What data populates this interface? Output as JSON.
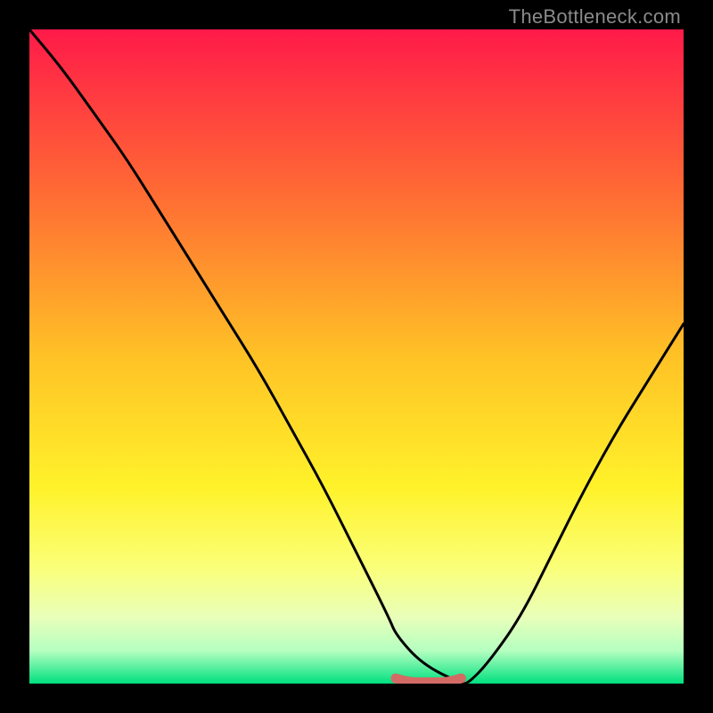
{
  "watermark": "TheBottleneck.com",
  "chart_data": {
    "type": "line",
    "title": "",
    "xlabel": "",
    "ylabel": "",
    "xlim": [
      0,
      100
    ],
    "ylim": [
      0,
      100
    ],
    "legend": false,
    "grid": false,
    "background_gradient": {
      "stops": [
        {
          "pos": 0.0,
          "color": "#ff1a49"
        },
        {
          "pos": 0.25,
          "color": "#ff6b34"
        },
        {
          "pos": 0.5,
          "color": "#ffc226"
        },
        {
          "pos": 0.7,
          "color": "#fff22a"
        },
        {
          "pos": 0.82,
          "color": "#fbff77"
        },
        {
          "pos": 0.9,
          "color": "#e8ffba"
        },
        {
          "pos": 0.95,
          "color": "#b4ffc0"
        },
        {
          "pos": 1.0,
          "color": "#00e07f"
        }
      ]
    },
    "series": [
      {
        "name": "bottleneck-curve",
        "color": "#000000",
        "x": [
          0,
          5,
          10,
          15,
          20,
          25,
          30,
          35,
          40,
          45,
          50,
          55,
          56,
          60,
          66,
          67,
          70,
          75,
          80,
          85,
          90,
          95,
          100
        ],
        "y_top": [
          100,
          94,
          87,
          80,
          72,
          64,
          56,
          48,
          39,
          30,
          20,
          10,
          7.5,
          3,
          0,
          0,
          3,
          10,
          20,
          30,
          39,
          47,
          55
        ]
      },
      {
        "name": "optimal-band",
        "color": "#d36b64",
        "x": [
          56,
          57,
          58,
          59,
          60,
          61,
          62,
          63,
          64,
          65,
          66
        ],
        "y_top": [
          0.8,
          0.5,
          0.3,
          0.2,
          0.2,
          0.2,
          0.2,
          0.2,
          0.3,
          0.5,
          0.8
        ]
      }
    ],
    "optimal_range_x": [
      56,
      66
    ]
  }
}
